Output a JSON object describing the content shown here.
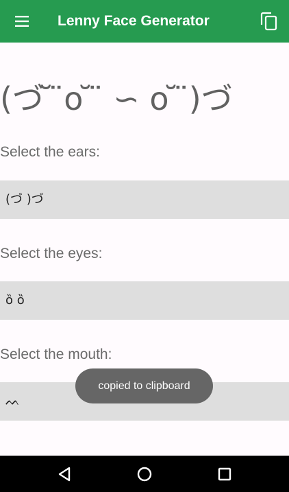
{
  "app_bar": {
    "title": "Lenny Face Generator",
    "menu_icon": "hamburger-menu-icon",
    "copy_icon": "copy-icon",
    "color": "#269b50"
  },
  "preview": {
    "face": "(づ ̆ ̈o ̆ ̈ ∽ o ̆ ̈)づ"
  },
  "ears": {
    "label": "Select the ears:",
    "selected": "(づ  )づ"
  },
  "eyes": {
    "label": "Select the eyes:",
    "selected": "ȍ ȍ"
  },
  "mouth": {
    "label": "Select the mouth:",
    "selected": "ᨓ"
  },
  "toast": {
    "text": "copied to clipboard"
  },
  "nav_bar": {
    "back_icon": "back-triangle-icon",
    "home_icon": "home-circle-icon",
    "recents_icon": "recents-square-icon"
  }
}
